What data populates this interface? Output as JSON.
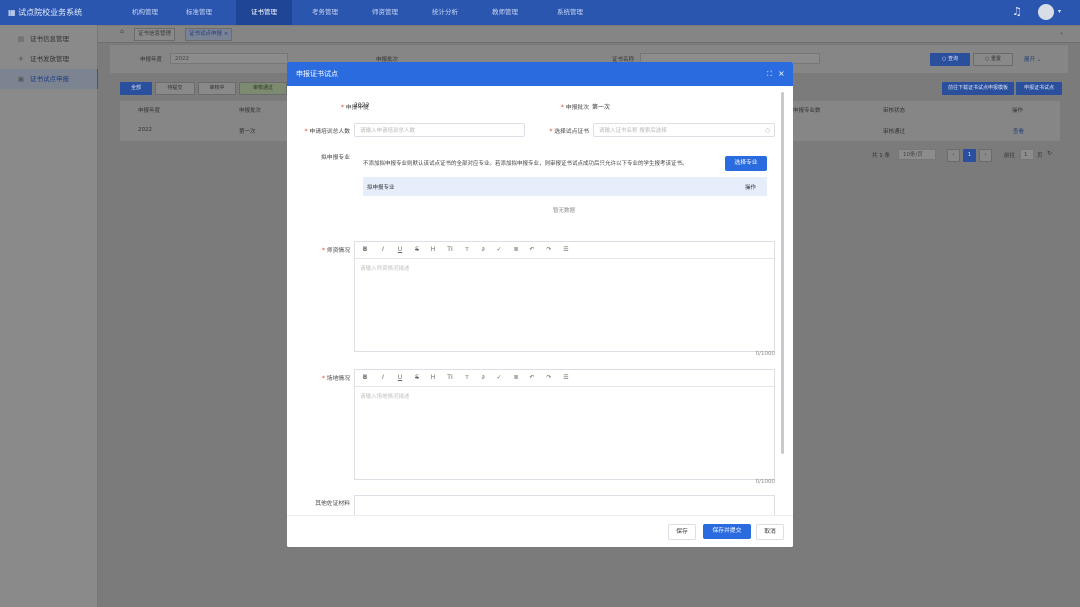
{
  "app": {
    "title": "试点院校业务系统"
  },
  "topnav": [
    "机构管理",
    "标准管理",
    "证书管理",
    "考务管理",
    "师资管理",
    "统计分析",
    "教师管理",
    "系统管理"
  ],
  "sidebar": [
    "证书信息管理",
    "证书发放管理",
    "证书试点申报"
  ],
  "tabs": [
    "证书信息管理",
    "证书试点申报"
  ],
  "filters": {
    "year_label": "申报年度",
    "year_value": "2022",
    "batch_label": "申报批次",
    "cert_label": "证书名称",
    "search": "查询",
    "reset": "重置",
    "expand": "展开"
  },
  "status_tabs": [
    "全部",
    "待提交",
    "审核中",
    "审核通过"
  ],
  "actions": {
    "download": "前往下载证书试点申报模板",
    "apply": "申报证书试点"
  },
  "table": {
    "headers": [
      "申报年度",
      "申报批次",
      "申报专业数",
      "审核状态",
      "操作"
    ],
    "row": [
      "2022",
      "第一次",
      "审核通过",
      "查看"
    ]
  },
  "pagination": {
    "total": "共 1 条",
    "per_page": "10条/页",
    "page": "1",
    "goto": "前往",
    "goto_page": "1",
    "page_unit": "页"
  },
  "modal": {
    "title": "申报证书试点",
    "fullscreen_icon": "fullscreen-icon",
    "year_label": "申报年度",
    "year_value": "2022",
    "batch_label": "申报批次",
    "batch_value": "第一次",
    "count_label": "申请培训总人数",
    "count_placeholder": "请输入申请培训总人数",
    "cert_label": "选择试点证书",
    "cert_placeholder": "请输入证书名称 搜索后选择",
    "major_label": "拟申报专业",
    "major_note": "不添加拟申报专业则默认该试点证书的全部对应专业。若添加拟申报专业，则审报证书试点成功后只允许以下专业的学生报考该证书。",
    "select_major_btn": "选择专业",
    "major_table_col": "拟申报专业",
    "major_table_action": "操作",
    "major_empty": "暂无数据",
    "teacher_label": "师资情况",
    "teacher_placeholder": "请输入师资情况描述",
    "teacher_count": "0/1000",
    "venue_label": "场地情况",
    "venue_placeholder": "请输入场地情况描述",
    "venue_count": "0/1000",
    "other_label": "其他佐证材料",
    "save": "保存",
    "save_submit": "保存并提交",
    "cancel": "取消"
  },
  "colors": {
    "primary": "#2a6ce0",
    "topbar": "#2a56b0",
    "required": "#e33333"
  }
}
